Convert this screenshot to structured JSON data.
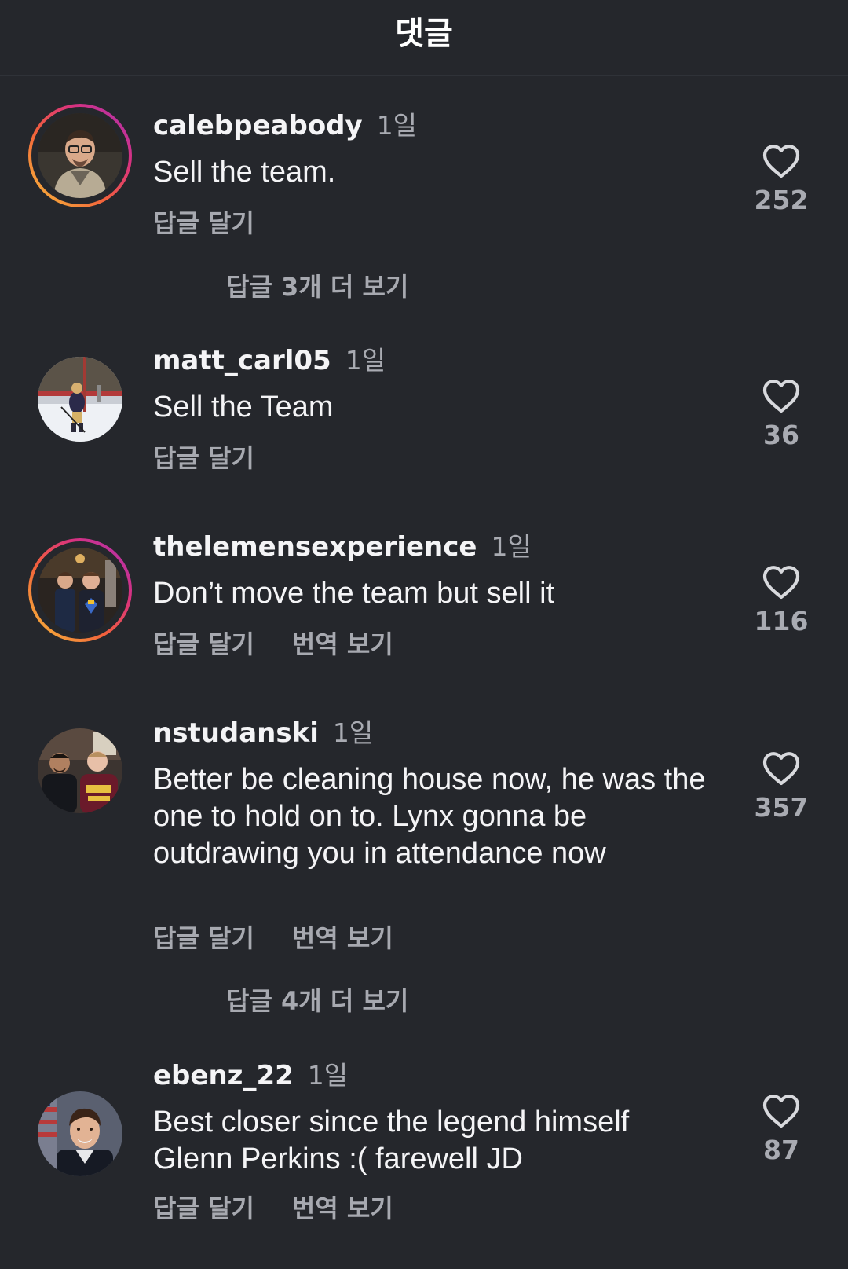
{
  "header": {
    "title": "댓글"
  },
  "comments": [
    {
      "username": "calebpeabody",
      "time": "1일",
      "text": "Sell the team.",
      "reply_label": "답글 달기",
      "likes": "252",
      "more_replies": "답글 3개 더 보기"
    },
    {
      "username": "matt_carl05",
      "time": "1일",
      "text": "Sell the Team",
      "reply_label": "답글 달기",
      "likes": "36"
    },
    {
      "username": "thelemensexperience",
      "time": "1일",
      "text": "Don’t move the team but sell it",
      "reply_label": "답글 달기",
      "translate_label": "번역 보기",
      "likes": "116"
    },
    {
      "username": "nstudanski",
      "time": "1일",
      "text": "Better be cleaning house now, he was the one to hold on to. Lynx gonna be outdrawing you in attendance now",
      "reply_label": "답글 달기",
      "translate_label": "번역 보기",
      "likes": "357",
      "more_replies": "답글 4개 더 보기"
    },
    {
      "username": "ebenz_22",
      "time": "1일",
      "text": "Best closer since the legend himself Glenn Perkins :( farewell JD",
      "reply_label": "답글 달기",
      "translate_label": "번역 보기",
      "likes": "87"
    }
  ],
  "icons": {
    "like": "heart-outline-icon"
  },
  "colors": {
    "background": "#25272c",
    "text": "#f4f4f6",
    "muted": "#a9abb2",
    "story_ring": [
      "#f7c23a",
      "#f2613b",
      "#d9327e",
      "#a533b8"
    ]
  }
}
